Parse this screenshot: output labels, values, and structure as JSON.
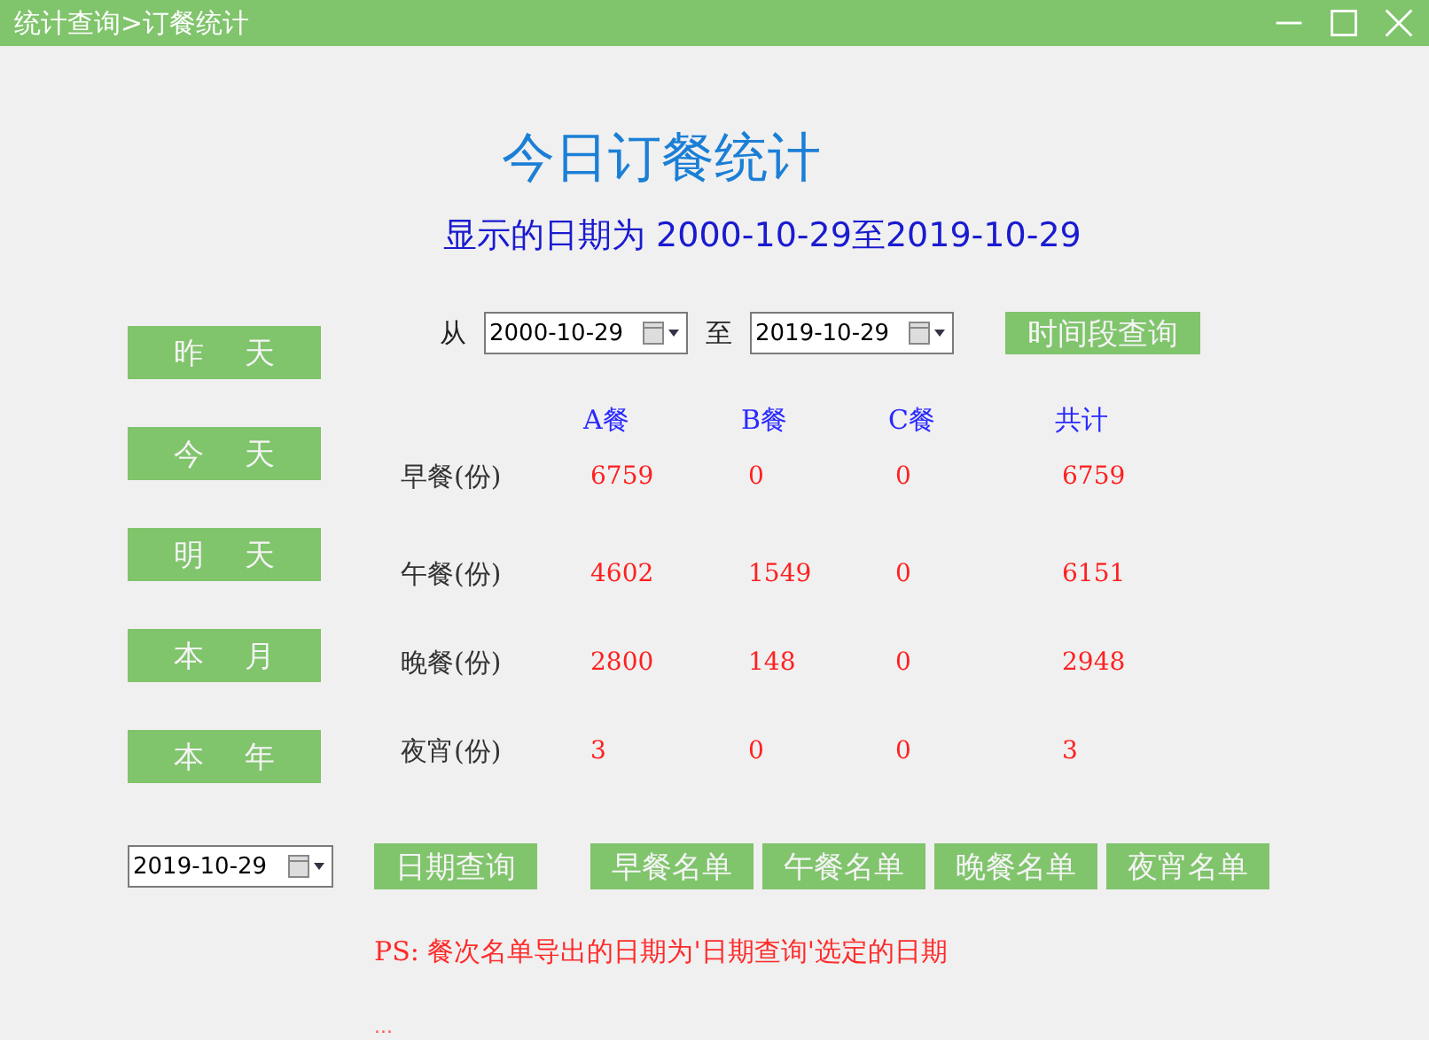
{
  "window": {
    "title": "统计查询>订餐统计"
  },
  "heading": "今日订餐统计",
  "subtitle": "显示的日期为 2000-10-29至2019-10-29",
  "quick_buttons": [
    "昨 天",
    "今 天",
    "明 天",
    "本 月",
    "本 年"
  ],
  "range": {
    "from_label": "从",
    "from": "2000-10-29",
    "to_label": "至",
    "to": "2019-10-29",
    "button": "时间段查询"
  },
  "table": {
    "columns": [
      "A餐",
      "B餐",
      "C餐",
      "共计"
    ],
    "rows": [
      {
        "label": "早餐(份)",
        "values": [
          "6759",
          "0",
          "0",
          "6759"
        ]
      },
      {
        "label": "午餐(份)",
        "values": [
          "4602",
          "1549",
          "0",
          "6151"
        ]
      },
      {
        "label": "晚餐(份)",
        "values": [
          "2800",
          "148",
          "0",
          "2948"
        ]
      },
      {
        "label": "夜宵(份)",
        "values": [
          "3",
          "0",
          "0",
          "3"
        ]
      }
    ]
  },
  "date_query": {
    "date": "2019-10-29",
    "button": "日期查询"
  },
  "list_buttons": [
    "早餐名单",
    "午餐名单",
    "晚餐名单",
    "夜宵名单"
  ],
  "note": "PS: 餐次名单导出的日期为'日期查询'选定的日期",
  "footer": "..."
}
